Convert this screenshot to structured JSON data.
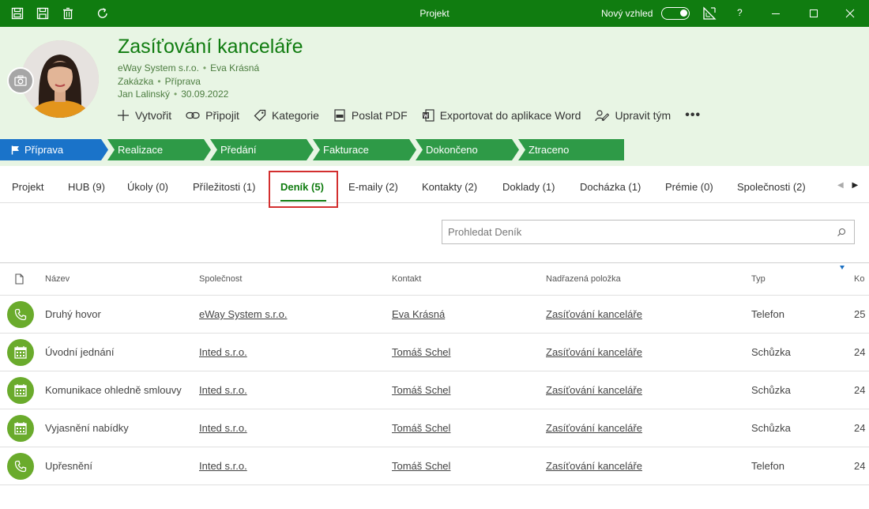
{
  "window": {
    "title": "Projekt",
    "new_look_label": "Nový vzhled",
    "help_label": "?"
  },
  "header": {
    "title": "Zasíťování kanceláře",
    "company": "eWay System s.r.o.",
    "contact": "Eva Krásná",
    "type": "Zakázka",
    "state": "Příprava",
    "owner": "Jan Lalinský",
    "date": "30.09.2022",
    "actions": {
      "create": "Vytvořit",
      "connect": "Připojit",
      "category": "Kategorie",
      "send_pdf": "Poslat PDF",
      "export_word": "Exportovat do aplikace Word",
      "edit_team": "Upravit tým",
      "more": "•••"
    }
  },
  "stages": [
    "Příprava",
    "Realizace",
    "Předání",
    "Fakturace",
    "Dokončeno",
    "Ztraceno"
  ],
  "tabs": [
    "Projekt",
    "HUB (9)",
    "Úkoly (0)",
    "Příležitosti (1)",
    "Deník (5)",
    "E-maily (2)",
    "Kontakty (2)",
    "Doklady (1)",
    "Docházka (1)",
    "Prémie (0)",
    "Společnosti (2)"
  ],
  "search": {
    "placeholder": "Prohledat Deník"
  },
  "columns": {
    "name": "Název",
    "company": "Společnost",
    "contact": "Kontakt",
    "parent": "Nadřazená položka",
    "type": "Typ",
    "date_partial": "Ko"
  },
  "rows": [
    {
      "icon": "phone",
      "name": "Druhý hovor",
      "company": "eWay System s.r.o.",
      "contact": "Eva Krásná",
      "parent": "Zasíťování kanceláře",
      "type": "Telefon",
      "date": "25"
    },
    {
      "icon": "calendar",
      "name": "Úvodní jednání",
      "company": "Inted s.r.o.",
      "contact": "Tomáš Schel",
      "parent": "Zasíťování kanceláře",
      "type": "Schůzka",
      "date": "24"
    },
    {
      "icon": "calendar",
      "name": "Komunikace ohledně smlouvy",
      "company": "Inted s.r.o.",
      "contact": "Tomáš Schel",
      "parent": "Zasíťování kanceláře",
      "type": "Schůzka",
      "date": "24"
    },
    {
      "icon": "calendar",
      "name": "Vyjasnění nabídky",
      "company": "Inted s.r.o.",
      "contact": "Tomáš Schel",
      "parent": "Zasíťování kanceláře",
      "type": "Schůzka",
      "date": "24"
    },
    {
      "icon": "phone",
      "name": "Upřesnění",
      "company": "Inted s.r.o.",
      "contact": "Tomáš Schel",
      "parent": "Zasíťování kanceláře",
      "type": "Telefon",
      "date": "24"
    }
  ],
  "colors": {
    "brand_green": "#107c10",
    "stage_green": "#2e9a47",
    "stage_active": "#1a73c9",
    "header_bg": "#e8f5e4",
    "row_icon": "#6aab2c",
    "highlight": "#d32f2f"
  }
}
